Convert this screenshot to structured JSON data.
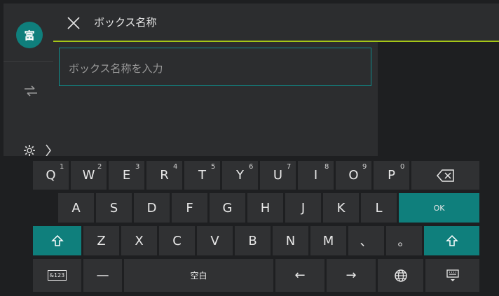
{
  "header": {
    "title": "ボックス名称"
  },
  "avatar": {
    "label": "富"
  },
  "input": {
    "placeholder": "ボックス名称を入力"
  },
  "keyboard": {
    "row1": [
      {
        "key": "Q",
        "num": "1"
      },
      {
        "key": "W",
        "num": "2"
      },
      {
        "key": "E",
        "num": "3"
      },
      {
        "key": "R",
        "num": "4"
      },
      {
        "key": "T",
        "num": "5"
      },
      {
        "key": "Y",
        "num": "6"
      },
      {
        "key": "U",
        "num": "7"
      },
      {
        "key": "I",
        "num": "8"
      },
      {
        "key": "O",
        "num": "9"
      },
      {
        "key": "P",
        "num": "0"
      }
    ],
    "row2": [
      "A",
      "S",
      "D",
      "F",
      "G",
      "H",
      "J",
      "K",
      "L"
    ],
    "ok": "OK",
    "row3": [
      "Z",
      "X",
      "C",
      "V",
      "B",
      "N",
      "M",
      "、",
      "。"
    ],
    "mode": "&123",
    "dash": "—",
    "space": "空白",
    "left_arrow": "←",
    "right_arrow": "→",
    "colors": {
      "accent": "#0f7f7c",
      "underline": "#a5c617",
      "key_bg": "#303133"
    }
  }
}
